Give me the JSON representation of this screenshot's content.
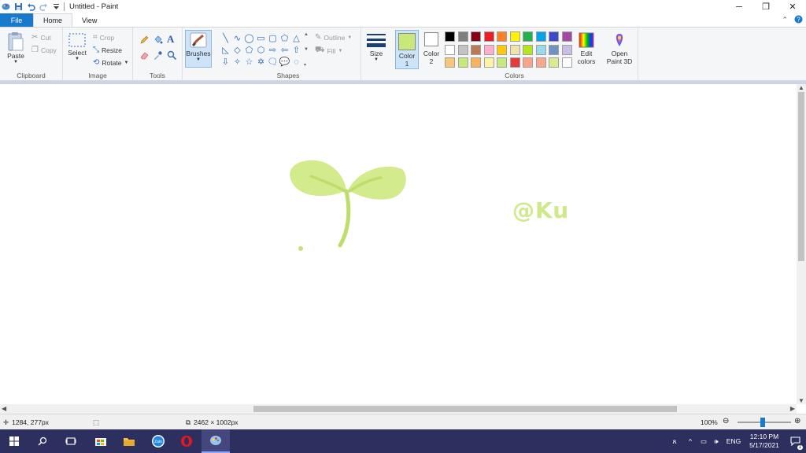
{
  "window": {
    "title": "Untitled - Paint"
  },
  "tabs": [
    {
      "label": "File"
    },
    {
      "label": "Home"
    },
    {
      "label": "View"
    }
  ],
  "clipboard": {
    "paste": "Paste",
    "cut": "Cut",
    "copy": "Copy",
    "group": "Clipboard"
  },
  "image": {
    "select": "Select",
    "crop": "Crop",
    "resize": "Resize",
    "rotate": "Rotate",
    "group": "Image"
  },
  "tools": {
    "group": "Tools",
    "text_glyph": "A"
  },
  "brushes": {
    "label": "Brushes"
  },
  "shapes": {
    "outline": "Outline",
    "fill": "Fill",
    "group": "Shapes"
  },
  "size": {
    "label": "Size"
  },
  "colors": {
    "color1_label": "Color",
    "color1_num": "1",
    "color2_label": "Color",
    "color2_num": "2",
    "edit_colors_l1": "Edit",
    "edit_colors_l2": "colors",
    "group": "Colors",
    "color1": "#c9e87a",
    "color2": "#ffffff",
    "row1": [
      "#000000",
      "#7f7f7f",
      "#880015",
      "#ed1c24",
      "#ff7f27",
      "#fff200",
      "#22b14c",
      "#00a2e8",
      "#3f48cc",
      "#a349a4"
    ],
    "row2": [
      "#ffffff",
      "#c3c3c3",
      "#b97a57",
      "#ffaec9",
      "#ffc90e",
      "#efe4b0",
      "#b5e61d",
      "#99d9ea",
      "#7092be",
      "#c8bfe7"
    ],
    "row3": [
      "#f9c677",
      "#c9e87a",
      "#f9b35a",
      "#fdf4a3",
      "#c6ea7f",
      "#e63b3b",
      "#f9a38b",
      "#f6a78e",
      "#d8ec8e",
      "#ffffff"
    ]
  },
  "paint3d": {
    "l1": "Open",
    "l2": "Paint 3D"
  },
  "canvas": {
    "watermark": "@Ku",
    "ink_color": "#cfe88a"
  },
  "status": {
    "cursor": "1284, 277px",
    "dimensions": "2462 × 1002px",
    "zoom": "100%"
  },
  "taskbar": {
    "lang": "ENG",
    "time": "12:10 PM",
    "date": "5/17/2021",
    "notify_count": "1"
  }
}
